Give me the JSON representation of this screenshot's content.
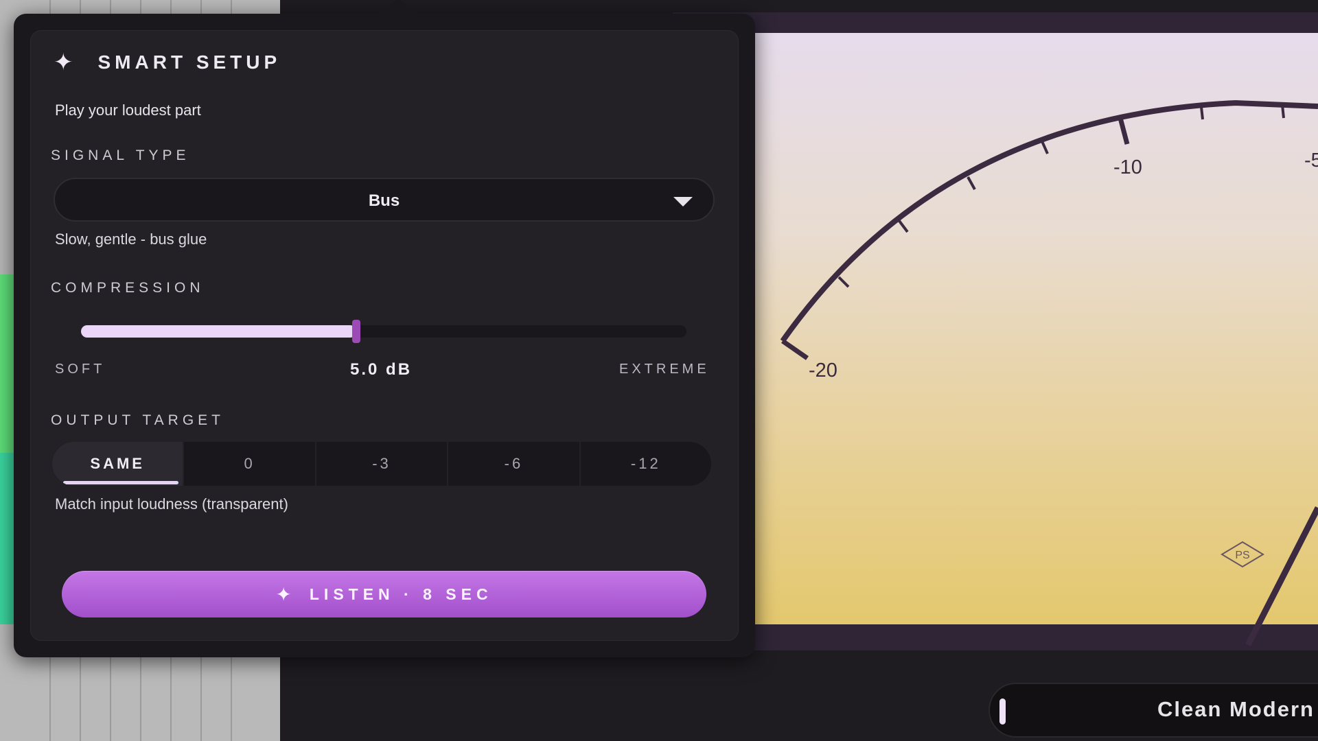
{
  "smart_setup": {
    "title": "SMART SETUP",
    "subtitle": "Play your loudest part",
    "signal_type": {
      "label": "SIGNAL TYPE",
      "selected": "Bus",
      "description": "Slow, gentle - bus glue"
    },
    "compression": {
      "label": "COMPRESSION",
      "min_label": "SOFT",
      "max_label": "EXTREME",
      "value_text": "5.0 dB",
      "level": 0.455
    },
    "output_target": {
      "label": "OUTPUT TARGET",
      "options": [
        "SAME",
        "0",
        "-3",
        "-6",
        "-12"
      ],
      "selected": "SAME",
      "description": "Match input loudness (transparent)"
    },
    "listen_button": {
      "label": "LISTEN  ·  8 SEC",
      "icon": "sparkle-icon"
    },
    "title_icon": "sparkle-icon"
  },
  "meter": {
    "labels": [
      "-20",
      "-10",
      "-5"
    ],
    "brand": "PS"
  },
  "preset": {
    "name": "Clean Modern"
  },
  "colors": {
    "accent": "#b15fd6",
    "slider_fill": "#ead7f7",
    "thumb": "#9c4bb6"
  }
}
